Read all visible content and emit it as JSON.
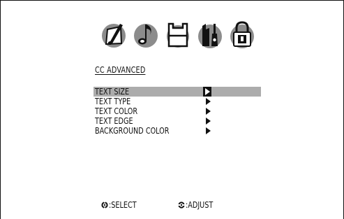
{
  "tabs": [
    {
      "icon": "picture-brush-icon",
      "selected": false
    },
    {
      "icon": "audio-note-icon",
      "selected": false
    },
    {
      "icon": "setup-icon",
      "selected": true
    },
    {
      "icon": "tools-icon",
      "selected": false
    },
    {
      "icon": "lock-icon",
      "selected": false
    }
  ],
  "menu": {
    "title": "CC ADVANCED",
    "items": [
      {
        "label": "TEXT SIZE",
        "selected": true
      },
      {
        "label": "TEXT TYPE",
        "selected": false
      },
      {
        "label": "TEXT COLOR",
        "selected": false
      },
      {
        "label": "TEXT EDGE",
        "selected": false
      },
      {
        "label": "BACKGROUND COLOR",
        "selected": false
      }
    ]
  },
  "hints": {
    "select": {
      "icon": "remote-select-icon",
      "label": ":SELECT"
    },
    "adjust": {
      "icon": "remote-adjust-icon",
      "label": ":ADJUST"
    }
  },
  "colors": {
    "highlight": "#acacac",
    "icon_fill": "#8c8c8c",
    "text": "#111111"
  }
}
